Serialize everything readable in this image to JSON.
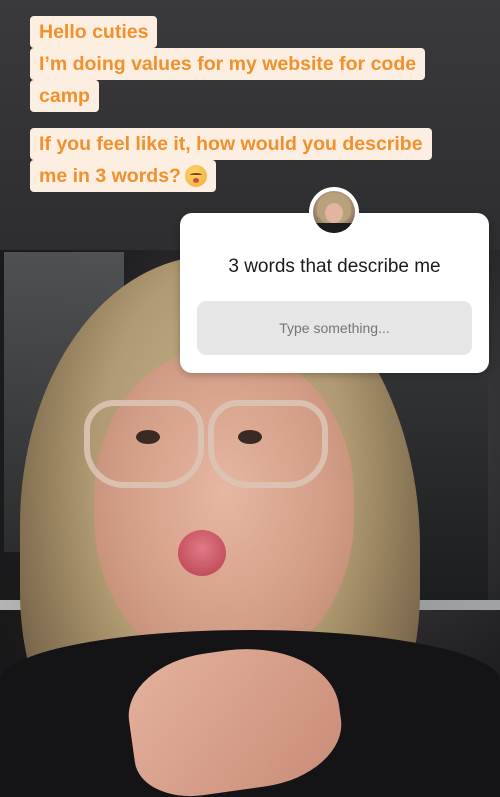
{
  "captions": {
    "top": [
      "Hello cuties",
      "I’m doing values for my website for code",
      "camp"
    ],
    "question": [
      "If you feel like it, how would you describe",
      "me in 3 words?"
    ]
  },
  "question_sticker": {
    "title": "3 words that describe me",
    "placeholder": "Type something..."
  },
  "icons": {
    "emoji": "kissing-face-with-smiling-eyes",
    "avatar": "profile-photo"
  },
  "colors": {
    "caption_text": "#f1902c",
    "caption_background": "#fcefe2",
    "sticker_background": "#ffffff",
    "input_background": "#e6e6e6"
  }
}
